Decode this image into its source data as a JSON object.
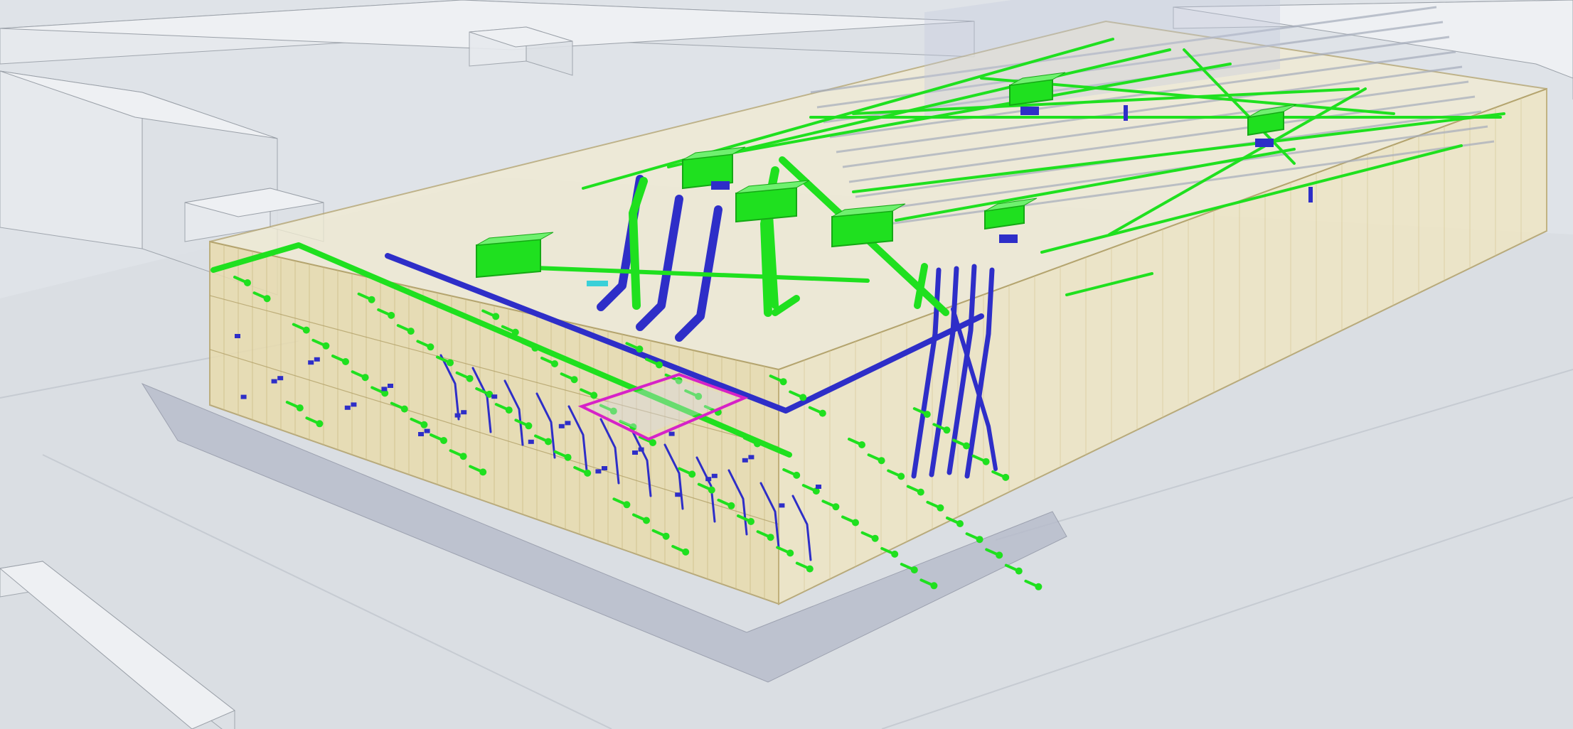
{
  "colors": {
    "background": "#dfe3e8",
    "ground": "#d7dbe1",
    "context_fill": "#e7eaee",
    "context_line": "#9aa0a8",
    "envelope_fill": "#e9dcae",
    "envelope_line": "#b3a26a",
    "podium_fill": "#b7bccb",
    "supply_duct": "#1fe01f",
    "supply_duct_dark": "#15a815",
    "return_duct": "#2e2ec8",
    "return_duct_dark": "#1c1c86",
    "atrium_outline": "#d622c8",
    "accent_cyan": "#3ad0d8",
    "accent_yellow": "#e7c531"
  },
  "icons": {
    "ground": "ground-plane",
    "context": "context-building-icon",
    "envelope": "building-envelope-icon",
    "supply": "supply-duct-icon",
    "return": "return-duct-icon",
    "ahu": "air-handling-unit-icon",
    "diffuser": "air-terminal-icon",
    "atrium": "atrium-void-icon"
  }
}
